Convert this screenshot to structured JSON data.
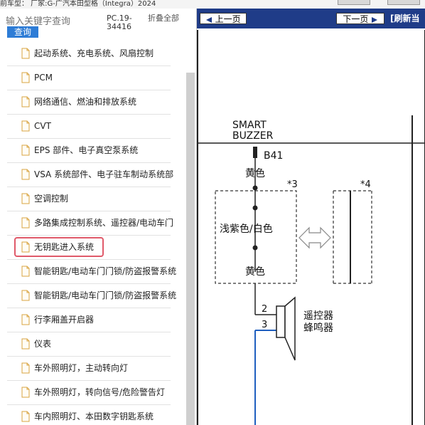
{
  "topbar": {
    "text": "前车型： 厂家:G-广汽本田型格（Integra）2024"
  },
  "sidebar": {
    "search_placeholder": "输入关键字查询",
    "query_label": "查询",
    "pc_code": "PC.19-34416",
    "fold_label": "折叠全部",
    "items": [
      {
        "label": "起动系统、充电系统、风扇控制",
        "selected": false
      },
      {
        "label": "PCM",
        "selected": false
      },
      {
        "label": "网络通信、燃油和排放系统",
        "selected": false
      },
      {
        "label": "CVT",
        "selected": false
      },
      {
        "label": "EPS 部件、电子真空泵系统",
        "selected": false
      },
      {
        "label": "VSA 系统部件、电子驻车制动系统部",
        "selected": false
      },
      {
        "label": "空调控制",
        "selected": false
      },
      {
        "label": "多路集成控制系统、遥控器/电动车门",
        "selected": false
      },
      {
        "label": "无钥匙进入系统",
        "selected": true
      },
      {
        "label": "智能钥匙/电动车门门锁/防盗报警系统",
        "selected": false
      },
      {
        "label": "智能钥匙/电动车门门锁/防盗报警系统",
        "selected": false
      },
      {
        "label": "行李厢盖开启器",
        "selected": false
      },
      {
        "label": "仪表",
        "selected": false
      },
      {
        "label": "车外照明灯，主动转向灯",
        "selected": false
      },
      {
        "label": "车外照明灯，转向信号/危险警告灯",
        "selected": false
      },
      {
        "label": "车内照明灯、本田数字钥匙系统",
        "selected": false
      }
    ]
  },
  "viewer": {
    "prev_label": "上一页",
    "next_label": "下一页",
    "refresh_label": "[刷新当",
    "diagram": {
      "component_line1": "SMART",
      "component_line2": "BUZZER",
      "connector": "B41",
      "wire_top": "黄色",
      "box_note_left": "*3",
      "box_note_right": "*4",
      "wire_mid": "浅紫色/白色",
      "wire_bottom": "黄色",
      "pin_a": "2",
      "pin_b": "3",
      "device_line1": "遥控器",
      "device_line2": "蜂鸣器"
    }
  },
  "colors": {
    "nav_bg": "#1f3c88",
    "query_btn": "#2d7cd6",
    "highlight": "#e05a6a",
    "wire_blue": "#1f5fbf"
  }
}
